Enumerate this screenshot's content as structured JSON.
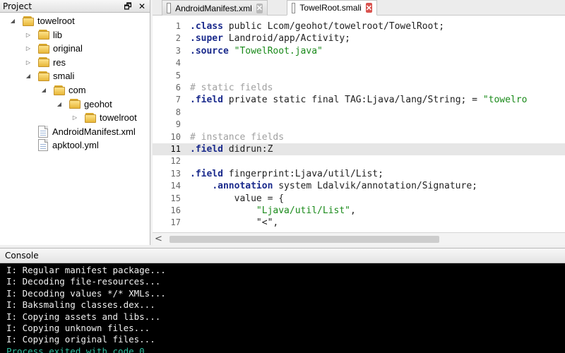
{
  "project_panel": {
    "title": "Project",
    "restore_glyph": "🗗",
    "close_glyph": "✕",
    "tree": [
      {
        "label": "towelroot",
        "type": "folder",
        "depth": 0,
        "expanded": true
      },
      {
        "label": "lib",
        "type": "folder",
        "depth": 1,
        "expanded": false
      },
      {
        "label": "original",
        "type": "folder",
        "depth": 1,
        "expanded": false
      },
      {
        "label": "res",
        "type": "folder",
        "depth": 1,
        "expanded": false
      },
      {
        "label": "smali",
        "type": "folder",
        "depth": 1,
        "expanded": true
      },
      {
        "label": "com",
        "type": "folder",
        "depth": 2,
        "expanded": true
      },
      {
        "label": "geohot",
        "type": "folder",
        "depth": 3,
        "expanded": true
      },
      {
        "label": "towelroot",
        "type": "folder",
        "depth": 4,
        "expanded": false
      },
      {
        "label": "AndroidManifest.xml",
        "type": "file",
        "depth": 1
      },
      {
        "label": "apktool.yml",
        "type": "file",
        "depth": 1
      }
    ]
  },
  "editor": {
    "tabs": [
      {
        "label": "AndroidManifest.xml",
        "active": false
      },
      {
        "label": "TowelRoot.smali",
        "active": true
      }
    ],
    "current_line": 11,
    "lines": [
      {
        "n": "1",
        "kw": ".class",
        "rest": " public Lcom/geohot/towelroot/TowelRoot;"
      },
      {
        "n": "2",
        "kw": ".super",
        "rest": " Landroid/app/Activity;"
      },
      {
        "n": "3",
        "kw": ".source",
        "rest": " ",
        "str": "\"TowelRoot.java\""
      },
      {
        "n": "4"
      },
      {
        "n": "5"
      },
      {
        "n": "6",
        "cmt": "# static fields"
      },
      {
        "n": "7",
        "kw": ".field",
        "rest": " private static final TAG:Ljava/lang/String; = ",
        "str": "\"towelro"
      },
      {
        "n": "8"
      },
      {
        "n": "9"
      },
      {
        "n": "10",
        "cmt": "# instance fields"
      },
      {
        "n": "11",
        "kw": ".field",
        "rest": " didrun:Z"
      },
      {
        "n": "12"
      },
      {
        "n": "13",
        "kw": ".field",
        "rest": " fingerprint:Ljava/util/List;"
      },
      {
        "n": "14",
        "indent": "    ",
        "kw": ".annotation",
        "rest": " system Ldalvik/annotation/Signature;"
      },
      {
        "n": "15",
        "indent": "        ",
        "rest": "value = {"
      },
      {
        "n": "16",
        "indent": "            ",
        "str": "\"Ljava/util/List\"",
        "tail": ","
      },
      {
        "n": "17",
        "indent": "            ",
        "rest": "\"<\","
      }
    ]
  },
  "scrollbar": {
    "left_glyph": "<"
  },
  "console": {
    "title": "Console",
    "lines": [
      {
        "text": "I: Regular manifest package...",
        "exit": false
      },
      {
        "text": "I: Decoding file-resources...",
        "exit": false
      },
      {
        "text": "I: Decoding values */* XMLs...",
        "exit": false
      },
      {
        "text": "I: Baksmaling classes.dex...",
        "exit": false
      },
      {
        "text": "I: Copying assets and libs...",
        "exit": false
      },
      {
        "text": "I: Copying unknown files...",
        "exit": false
      },
      {
        "text": "I: Copying original files...",
        "exit": false
      },
      {
        "text": "Process exited with code 0",
        "exit": true
      }
    ]
  },
  "colors": {
    "keyword": "#1a2a8c",
    "string": "#1a8a1a",
    "comment": "#a0a0a0",
    "console_bg": "#000000",
    "console_exit": "#2fbf9f",
    "active_tab_close": "#d9534f"
  }
}
